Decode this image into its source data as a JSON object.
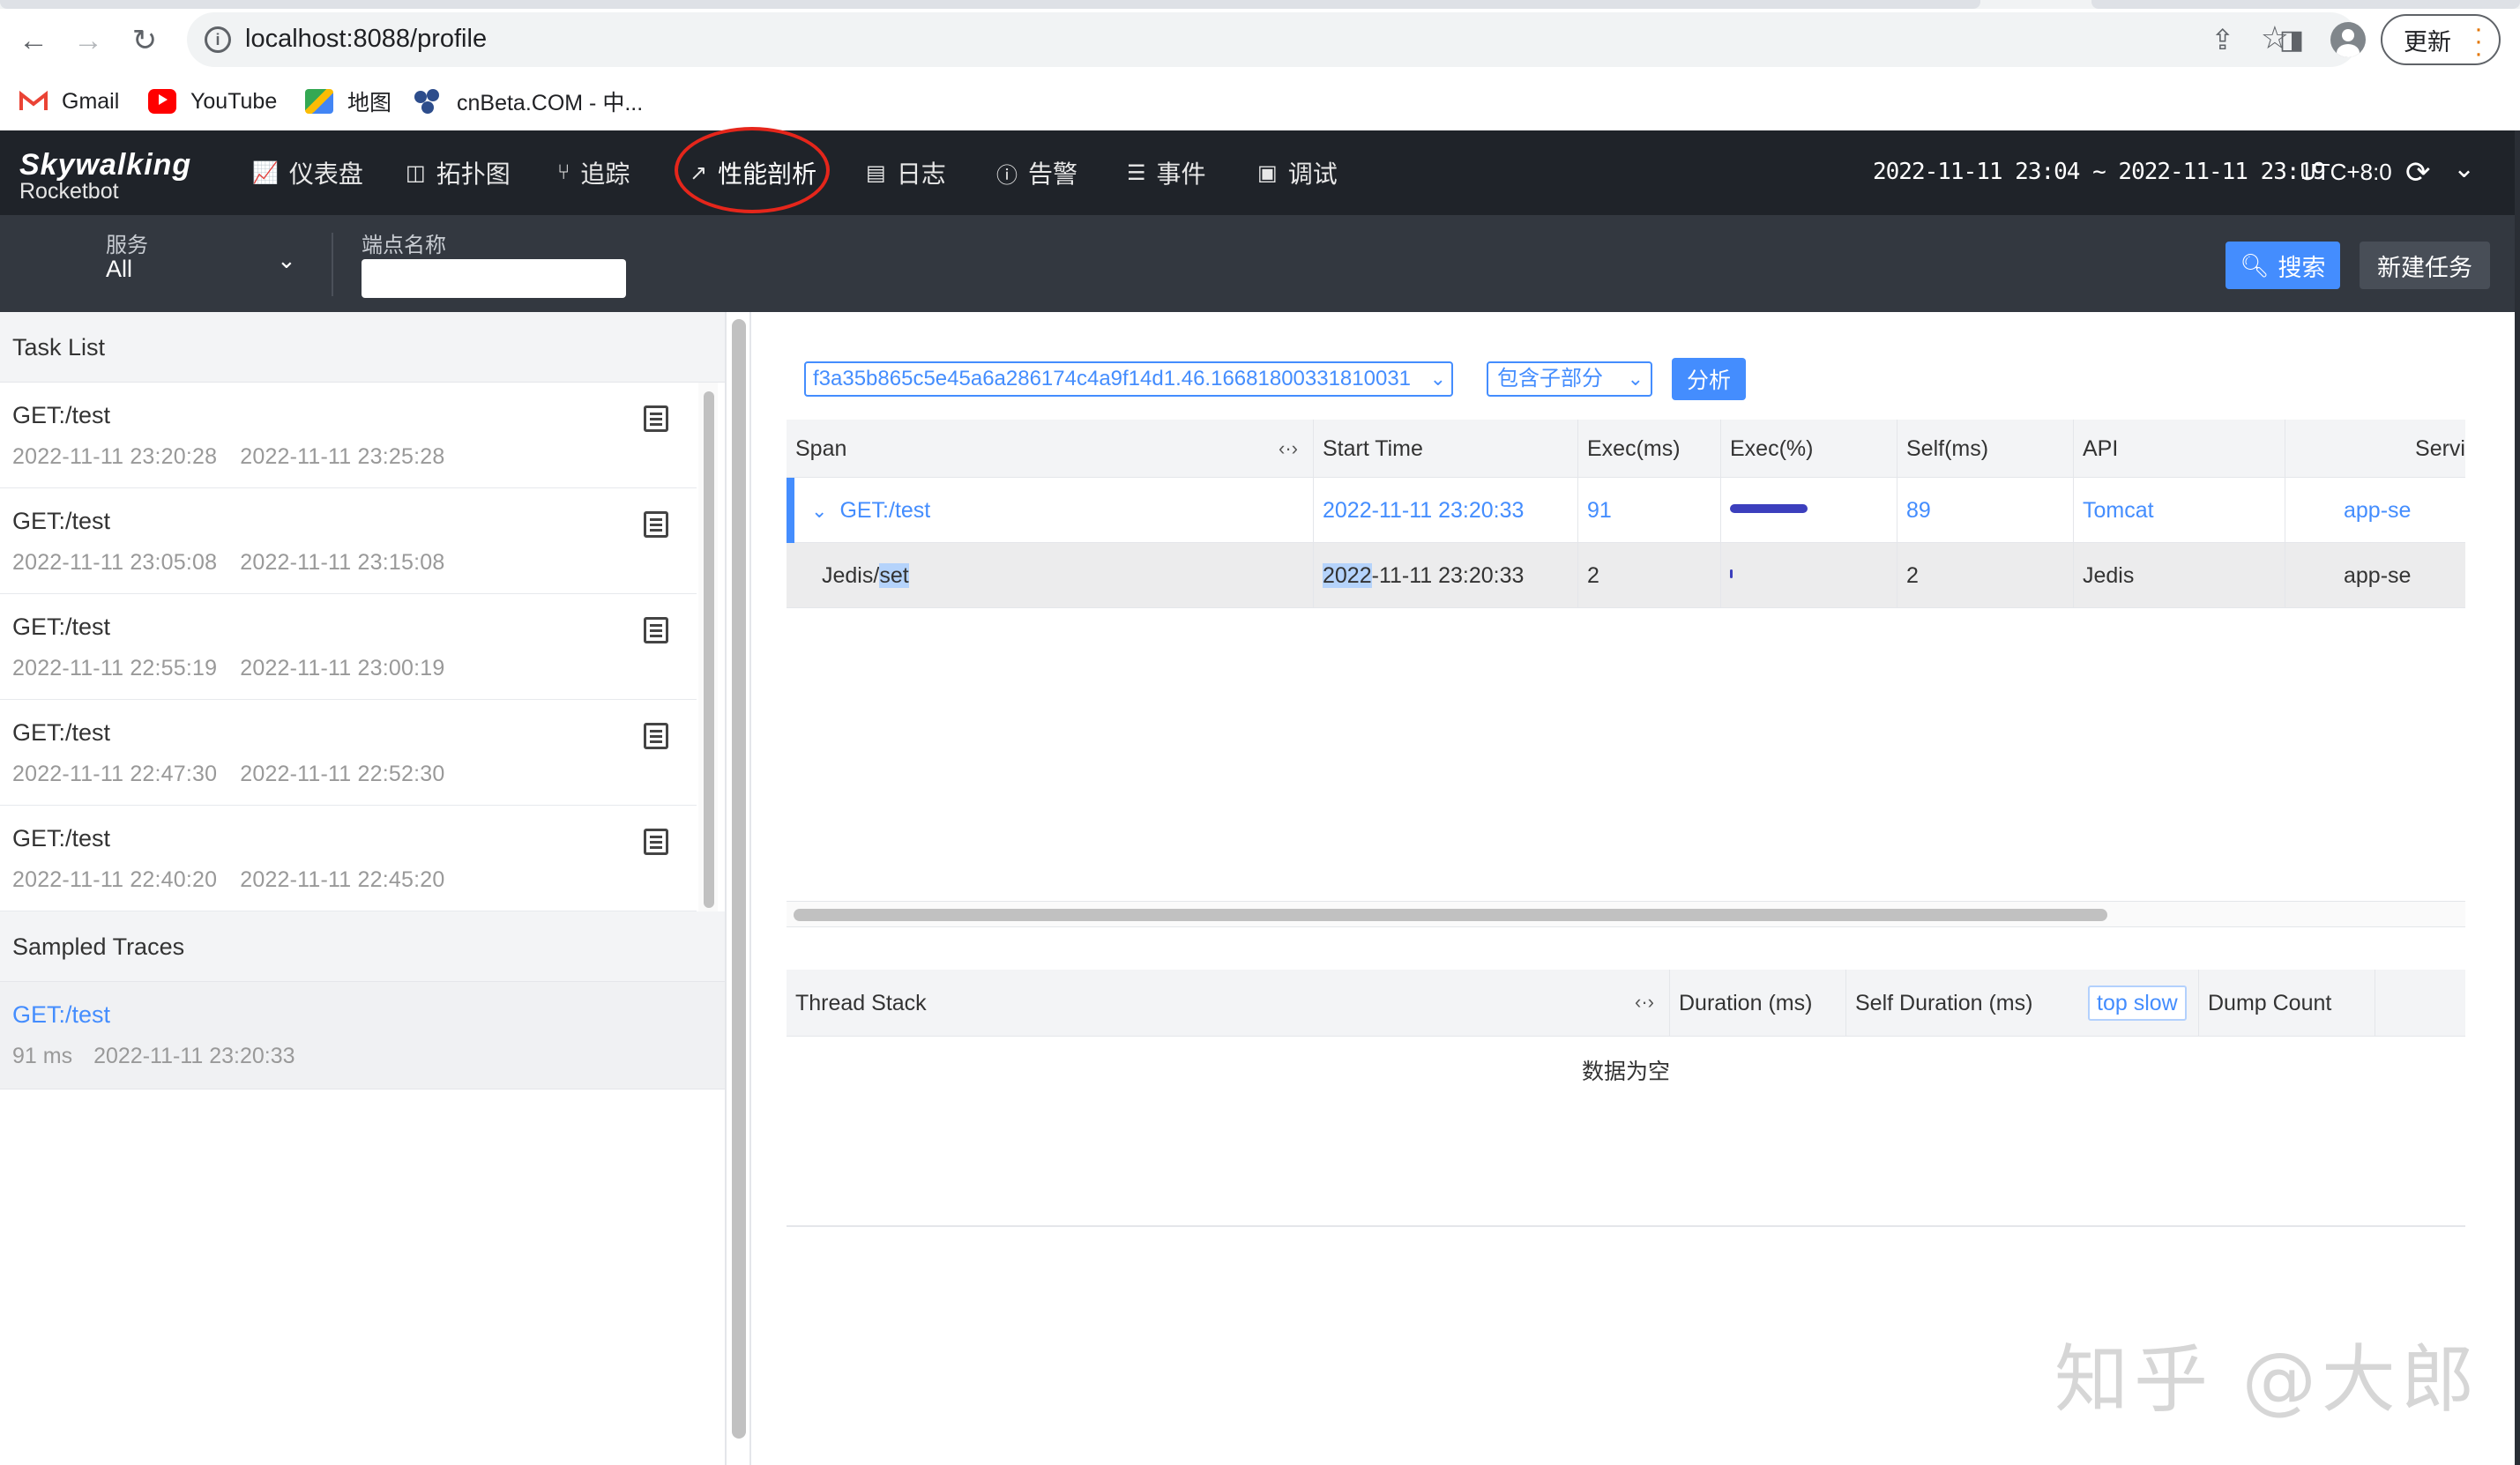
{
  "browser": {
    "url": "localhost:8088/profile",
    "update_label": "更新",
    "bookmarks": [
      {
        "label": "Gmail",
        "icon": "gmail-icon"
      },
      {
        "label": "YouTube",
        "icon": "youtube-icon"
      },
      {
        "label": "地图",
        "icon": "maps-icon"
      },
      {
        "label": "cnBeta.COM - 中...",
        "icon": "cnbeta-icon"
      }
    ]
  },
  "header": {
    "logo_main": "Skywalking",
    "logo_sub": "Rocketbot",
    "nav": [
      {
        "label": "仪表盘",
        "icon": "dashboard-icon"
      },
      {
        "label": "拓扑图",
        "icon": "topology-icon"
      },
      {
        "label": "追踪",
        "icon": "trace-icon"
      },
      {
        "label": "性能剖析",
        "icon": "profile-icon",
        "active": true
      },
      {
        "label": "日志",
        "icon": "log-icon"
      },
      {
        "label": "告警",
        "icon": "alarm-icon"
      },
      {
        "label": "事件",
        "icon": "event-icon"
      },
      {
        "label": "调试",
        "icon": "debug-icon"
      }
    ],
    "time_range": "2022-11-11 23:04 ~ 2022-11-11 23:19",
    "timezone": "UTC+8:0",
    "annotation_color": "#e5261b"
  },
  "filter": {
    "service_label": "服务",
    "service_value": "All",
    "endpoint_label": "端点名称",
    "endpoint_value": "",
    "search_label": "搜索",
    "new_task_label": "新建任务"
  },
  "task_list": {
    "title": "Task List",
    "items": [
      {
        "name": "GET:/test",
        "start": "2022-11-11 23:20:28",
        "end": "2022-11-11 23:25:28"
      },
      {
        "name": "GET:/test",
        "start": "2022-11-11 23:05:08",
        "end": "2022-11-11 23:15:08"
      },
      {
        "name": "GET:/test",
        "start": "2022-11-11 22:55:19",
        "end": "2022-11-11 23:00:19"
      },
      {
        "name": "GET:/test",
        "start": "2022-11-11 22:47:30",
        "end": "2022-11-11 22:52:30"
      },
      {
        "name": "GET:/test",
        "start": "2022-11-11 22:40:20",
        "end": "2022-11-11 22:45:20"
      }
    ]
  },
  "sampled_traces": {
    "title": "Sampled Traces",
    "items": [
      {
        "name": "GET:/test",
        "duration": "91 ms",
        "time": "2022-11-11 23:20:33"
      }
    ]
  },
  "analysis": {
    "segment_id": "f3a35b865c5e45a6a286174c4a9f14d1.46.16681800331810031",
    "mode": "包含子部分",
    "analyze_label": "分析"
  },
  "span_table": {
    "columns": [
      "Span",
      "Start Time",
      "Exec(ms)",
      "Exec(%)",
      "Self(ms)",
      "API",
      "Servi"
    ],
    "rows": [
      {
        "span": "GET:/test",
        "start_time": "2022-11-11 23:20:33",
        "exec_ms": "91",
        "exec_pct": 1.0,
        "self_ms": "89",
        "api": "Tomcat",
        "service": "app-se"
      },
      {
        "span_prefix": "Jedis/",
        "span_highlight": "set",
        "start_highlight": "2022",
        "start_rest": "-11-11 23:20:33",
        "exec_ms": "2",
        "exec_pct": 0.02,
        "self_ms": "2",
        "api": "Jedis",
        "service": "app-se"
      }
    ],
    "bar_color": "#3c3fbd"
  },
  "thread_table": {
    "columns": [
      "Thread Stack",
      "Duration (ms)",
      "Self Duration (ms)",
      "top slow",
      "Dump Count"
    ],
    "empty_text": "数据为空"
  },
  "watermark": "知乎 @大郎"
}
